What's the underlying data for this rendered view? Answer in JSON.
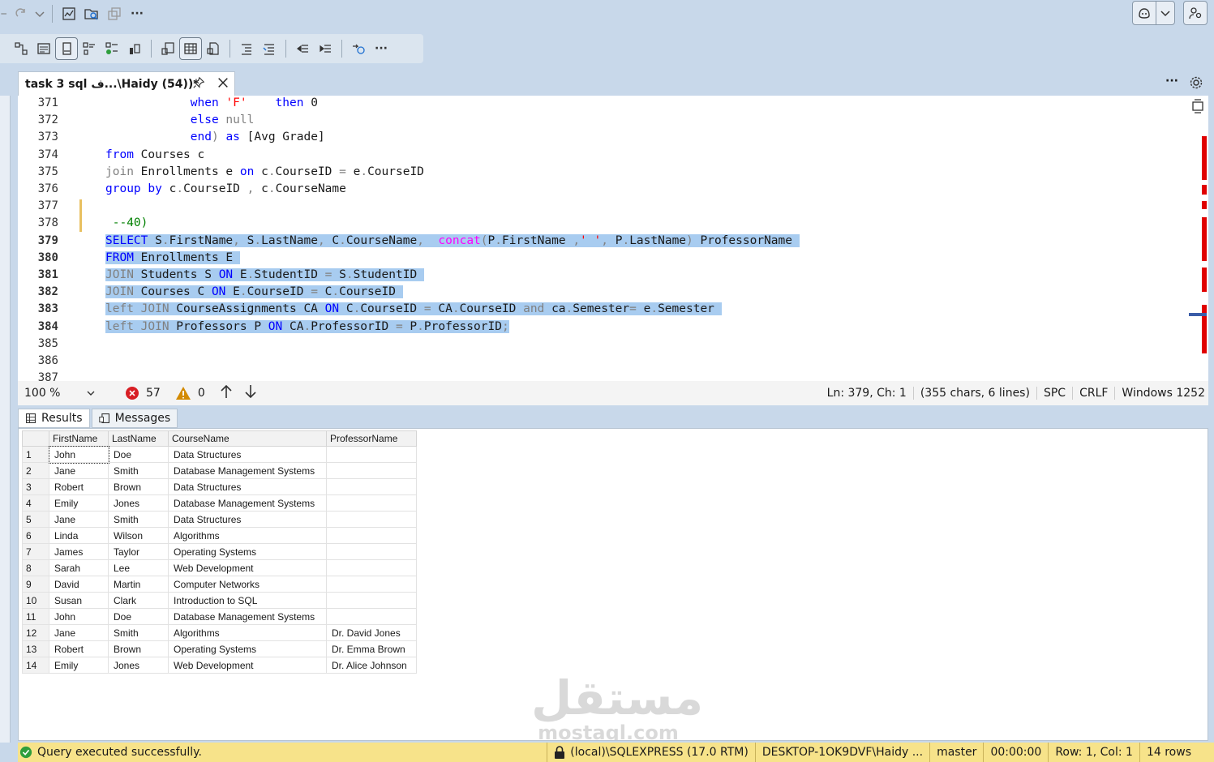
{
  "toolbar1": {
    "more_label": "···"
  },
  "toolbar2": {
    "more_label": "···"
  },
  "tab": {
    "title": "task 3 sql ف...\\Haidy (54))*"
  },
  "tabstrip": {
    "more_label": "···"
  },
  "editor": {
    "lines": [
      {
        "n": "371",
        "segs": [
          {
            "t": "            ",
            "c": "tx"
          },
          {
            "t": "when",
            "c": "kw"
          },
          {
            "t": " ",
            "c": "tx"
          },
          {
            "t": "'F'",
            "c": "str"
          },
          {
            "t": "    ",
            "c": "tx"
          },
          {
            "t": "then",
            "c": "kw"
          },
          {
            "t": " 0",
            "c": "tx"
          }
        ]
      },
      {
        "n": "372",
        "segs": [
          {
            "t": "            ",
            "c": "tx"
          },
          {
            "t": "else",
            "c": "kw"
          },
          {
            "t": " ",
            "c": "tx"
          },
          {
            "t": "null",
            "c": "op"
          }
        ]
      },
      {
        "n": "373",
        "segs": [
          {
            "t": "            ",
            "c": "tx"
          },
          {
            "t": "end",
            "c": "kw"
          },
          {
            "t": ")",
            "c": "op"
          },
          {
            "t": " ",
            "c": "tx"
          },
          {
            "t": "as",
            "c": "kw"
          },
          {
            "t": " [Avg Grade]",
            "c": "tx"
          }
        ]
      },
      {
        "n": "374",
        "segs": [
          {
            "t": "from",
            "c": "kw"
          },
          {
            "t": " Courses c",
            "c": "tx"
          }
        ]
      },
      {
        "n": "375",
        "segs": [
          {
            "t": "join",
            "c": "op"
          },
          {
            "t": " Enrollments e ",
            "c": "tx"
          },
          {
            "t": "on",
            "c": "kw"
          },
          {
            "t": " c",
            "c": "tx"
          },
          {
            "t": ".",
            "c": "op"
          },
          {
            "t": "CourseID ",
            "c": "tx"
          },
          {
            "t": "=",
            "c": "op"
          },
          {
            "t": " e",
            "c": "tx"
          },
          {
            "t": ".",
            "c": "op"
          },
          {
            "t": "CourseID",
            "c": "tx"
          }
        ]
      },
      {
        "n": "376",
        "segs": [
          {
            "t": "group",
            "c": "kw"
          },
          {
            "t": " ",
            "c": "tx"
          },
          {
            "t": "by",
            "c": "kw"
          },
          {
            "t": " c",
            "c": "tx"
          },
          {
            "t": ".",
            "c": "op"
          },
          {
            "t": "CourseID ",
            "c": "tx"
          },
          {
            "t": ",",
            "c": "op"
          },
          {
            "t": " c",
            "c": "tx"
          },
          {
            "t": ".",
            "c": "op"
          },
          {
            "t": "CourseName",
            "c": "tx"
          }
        ]
      },
      {
        "n": "377",
        "segs": []
      },
      {
        "n": "378",
        "segs": [
          {
            "t": " --40)",
            "c": "cm"
          }
        ]
      },
      {
        "n": "379",
        "hl": true,
        "segs": [
          {
            "t": "SELECT",
            "c": "kw"
          },
          {
            "t": " S",
            "c": "tx"
          },
          {
            "t": ".",
            "c": "op"
          },
          {
            "t": "FirstName",
            "c": "tx"
          },
          {
            "t": ",",
            "c": "op"
          },
          {
            "t": " S",
            "c": "tx"
          },
          {
            "t": ".",
            "c": "op"
          },
          {
            "t": "LastName",
            "c": "tx"
          },
          {
            "t": ",",
            "c": "op"
          },
          {
            "t": " C",
            "c": "tx"
          },
          {
            "t": ".",
            "c": "op"
          },
          {
            "t": "CourseName",
            "c": "tx"
          },
          {
            "t": ",",
            "c": "op"
          },
          {
            "t": "  ",
            "c": "tx"
          },
          {
            "t": "concat",
            "c": "fn"
          },
          {
            "t": "(",
            "c": "op"
          },
          {
            "t": "P",
            "c": "tx"
          },
          {
            "t": ".",
            "c": "op"
          },
          {
            "t": "FirstName ",
            "c": "tx"
          },
          {
            "t": ",",
            "c": "op"
          },
          {
            "t": "' '",
            "c": "str"
          },
          {
            "t": ",",
            "c": "op"
          },
          {
            "t": " P",
            "c": "tx"
          },
          {
            "t": ".",
            "c": "op"
          },
          {
            "t": "LastName",
            "c": "tx"
          },
          {
            "t": ")",
            "c": "op"
          },
          {
            "t": " ProfessorName ",
            "c": "tx"
          }
        ]
      },
      {
        "n": "380",
        "hl": true,
        "segs": [
          {
            "t": "FROM",
            "c": "kw"
          },
          {
            "t": " Enrollments E ",
            "c": "tx"
          }
        ]
      },
      {
        "n": "381",
        "hl": true,
        "segs": [
          {
            "t": "JOIN",
            "c": "op"
          },
          {
            "t": " Students S ",
            "c": "tx"
          },
          {
            "t": "ON",
            "c": "kw"
          },
          {
            "t": " E",
            "c": "tx"
          },
          {
            "t": ".",
            "c": "op"
          },
          {
            "t": "StudentID ",
            "c": "tx"
          },
          {
            "t": "=",
            "c": "op"
          },
          {
            "t": " S",
            "c": "tx"
          },
          {
            "t": ".",
            "c": "op"
          },
          {
            "t": "StudentID ",
            "c": "tx"
          }
        ]
      },
      {
        "n": "382",
        "hl": true,
        "segs": [
          {
            "t": "JOIN",
            "c": "op"
          },
          {
            "t": " Courses C ",
            "c": "tx"
          },
          {
            "t": "ON",
            "c": "kw"
          },
          {
            "t": " E",
            "c": "tx"
          },
          {
            "t": ".",
            "c": "op"
          },
          {
            "t": "CourseID ",
            "c": "tx"
          },
          {
            "t": "=",
            "c": "op"
          },
          {
            "t": " C",
            "c": "tx"
          },
          {
            "t": ".",
            "c": "op"
          },
          {
            "t": "CourseID ",
            "c": "tx"
          }
        ]
      },
      {
        "n": "383",
        "hl": true,
        "segs": [
          {
            "t": "left",
            "c": "op"
          },
          {
            "t": " ",
            "c": "tx"
          },
          {
            "t": "JOIN",
            "c": "op"
          },
          {
            "t": " CourseAssignments CA ",
            "c": "tx"
          },
          {
            "t": "ON",
            "c": "kw"
          },
          {
            "t": " C",
            "c": "tx"
          },
          {
            "t": ".",
            "c": "op"
          },
          {
            "t": "CourseID ",
            "c": "tx"
          },
          {
            "t": "=",
            "c": "op"
          },
          {
            "t": " CA",
            "c": "tx"
          },
          {
            "t": ".",
            "c": "op"
          },
          {
            "t": "CourseID ",
            "c": "tx"
          },
          {
            "t": "and",
            "c": "op"
          },
          {
            "t": " ca",
            "c": "tx"
          },
          {
            "t": ".",
            "c": "op"
          },
          {
            "t": "Semester",
            "c": "tx"
          },
          {
            "t": "=",
            "c": "op"
          },
          {
            "t": " e",
            "c": "tx"
          },
          {
            "t": ".",
            "c": "op"
          },
          {
            "t": "Semester ",
            "c": "tx"
          }
        ]
      },
      {
        "n": "384",
        "hl": true,
        "segs": [
          {
            "t": "left",
            "c": "op"
          },
          {
            "t": " ",
            "c": "tx"
          },
          {
            "t": "JOIN",
            "c": "op"
          },
          {
            "t": " Professors P ",
            "c": "tx"
          },
          {
            "t": "ON",
            "c": "kw"
          },
          {
            "t": " CA",
            "c": "tx"
          },
          {
            "t": ".",
            "c": "op"
          },
          {
            "t": "ProfessorID ",
            "c": "tx"
          },
          {
            "t": "=",
            "c": "op"
          },
          {
            "t": " P",
            "c": "tx"
          },
          {
            "t": ".",
            "c": "op"
          },
          {
            "t": "ProfessorID",
            "c": "tx"
          },
          {
            "t": ";",
            "c": "op"
          }
        ]
      },
      {
        "n": "385",
        "segs": []
      },
      {
        "n": "386",
        "segs": []
      },
      {
        "n": "387",
        "segs": []
      }
    ]
  },
  "status": {
    "zoom": "100 %",
    "errors": "57",
    "warnings": "0",
    "position": "Ln: 379, Ch: 1",
    "chars": "(355 chars, 6 lines)",
    "indent": "SPC",
    "eol": "CRLF",
    "encoding": "Windows 1252"
  },
  "results_tabs": [
    {
      "label": "Results"
    },
    {
      "label": "Messages"
    }
  ],
  "grid": {
    "columns": [
      "FirstName",
      "LastName",
      "CourseName",
      "ProfessorName"
    ],
    "rows": [
      [
        "1",
        "John",
        "Doe",
        "Data Structures",
        ""
      ],
      [
        "2",
        "Jane",
        "Smith",
        "Database Management Systems",
        ""
      ],
      [
        "3",
        "Robert",
        "Brown",
        "Data Structures",
        ""
      ],
      [
        "4",
        "Emily",
        "Jones",
        "Database Management Systems",
        ""
      ],
      [
        "5",
        "Jane",
        "Smith",
        "Data Structures",
        ""
      ],
      [
        "6",
        "Linda",
        "Wilson",
        "Algorithms",
        ""
      ],
      [
        "7",
        "James",
        "Taylor",
        "Operating Systems",
        ""
      ],
      [
        "8",
        "Sarah",
        "Lee",
        "Web Development",
        ""
      ],
      [
        "9",
        "David",
        "Martin",
        "Computer Networks",
        ""
      ],
      [
        "10",
        "Susan",
        "Clark",
        "Introduction to SQL",
        ""
      ],
      [
        "11",
        "John",
        "Doe",
        "Database Management Systems",
        ""
      ],
      [
        "12",
        "Jane",
        "Smith",
        "Algorithms",
        "Dr. David Jones"
      ],
      [
        "13",
        "Robert",
        "Brown",
        "Operating Systems",
        "Dr. Emma Brown"
      ],
      [
        "14",
        "Emily",
        "Jones",
        "Web Development",
        "Dr. Alice Johnson"
      ]
    ]
  },
  "bottom": {
    "message": "Query executed successfully.",
    "server": "(local)\\SQLEXPRESS (17.0 RTM)",
    "user": "DESKTOP-1OK9DVF\\Haidy ...",
    "database": "master",
    "elapsed": "00:00:00",
    "rowcol": "Row: 1, Col: 1",
    "rows": "14 rows"
  },
  "watermark": {
    "arabic": "مستقل",
    "latin": "mostaql.com"
  },
  "colors": {
    "keyword": "#0000ff",
    "string": "#ff0000",
    "function": "#ff00ff",
    "operator": "#808080",
    "comment": "#008000",
    "selection": "#a8ccf0",
    "status_ok": "#f7e38a"
  }
}
